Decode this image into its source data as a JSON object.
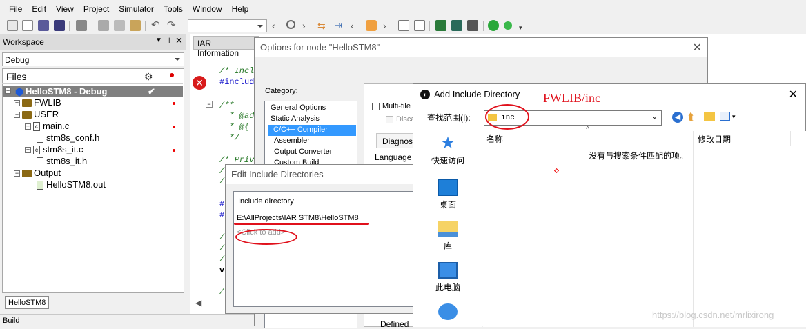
{
  "menu": [
    "File",
    "Edit",
    "View",
    "Project",
    "Simulator",
    "Tools",
    "Window",
    "Help"
  ],
  "workspace": {
    "title": "Workspace",
    "config": "Debug",
    "files_header": "Files",
    "tree": [
      {
        "label": "HelloSTM8 - Debug",
        "check": "✔"
      },
      {
        "label": "FWLIB"
      },
      {
        "label": "USER"
      },
      {
        "label": "main.c"
      },
      {
        "label": "stm8s_conf.h"
      },
      {
        "label": "stm8s_it.c"
      },
      {
        "label": "stm8s_it.h"
      },
      {
        "label": "Output"
      },
      {
        "label": "HelloSTM8.out"
      }
    ],
    "tab": "HelloSTM8"
  },
  "status": "Build",
  "editor": {
    "tab": "IAR Information",
    "lines": [
      "/* Incl",
      "#includ",
      "/**",
      "  * @ad",
      "  * @{",
      "  */",
      "/* Priv",
      "/",
      "/",
      "#",
      "#",
      "/",
      "/",
      "/",
      "v",
      "/"
    ]
  },
  "options_dialog": {
    "title": "Options for node \"HelloSTM8\"",
    "category_label": "Category:",
    "categories": [
      "General Options",
      "Static Analysis",
      "C/C++ Compiler",
      "Assembler",
      "Output Converter",
      "Custom Build"
    ],
    "multifile": "Multi-file C",
    "discard": "Disca",
    "tabs": [
      "Diagnos",
      "Language"
    ],
    "defined": "Defined"
  },
  "edit_include": {
    "title": "Edit Include Directories",
    "header": "Include directory",
    "path": "E:\\AllProjects\\IAR STM8\\HelloSTM8",
    "placeholder": "<Click to add>"
  },
  "add_include": {
    "title": "Add Include Directory",
    "annotation": "FWLIB/inc",
    "lookin_label": "查找范围(I):",
    "lookin_value": "inc",
    "col_name": "名称",
    "col_date": "修改日期",
    "empty_msg": "没有与搜索条件匹配的项。",
    "places": [
      "快速访问",
      "桌面",
      "库",
      "此电脑"
    ]
  },
  "watermark": "https://blog.csdn.net/mrlixirong"
}
